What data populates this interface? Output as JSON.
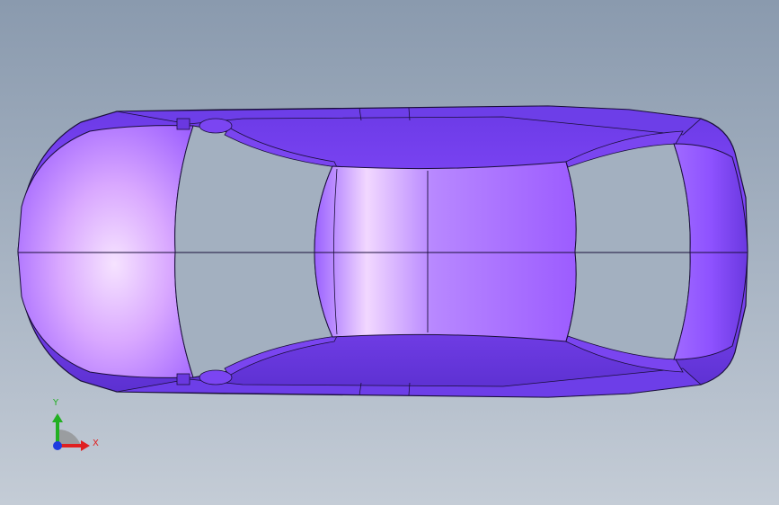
{
  "viewport": {
    "background_top": "#8a9aae",
    "background_bottom": "#c4ccd6"
  },
  "model": {
    "body_color": "#8a4dff",
    "highlight_color": "#f3d9ff",
    "shadow_color": "#4a2ba8",
    "edge_color": "#1a0f3a"
  },
  "triad": {
    "x_label": "X",
    "y_label": "Y",
    "x_color": "#e02020",
    "y_color": "#22b022",
    "z_color": "#1f3be0"
  }
}
